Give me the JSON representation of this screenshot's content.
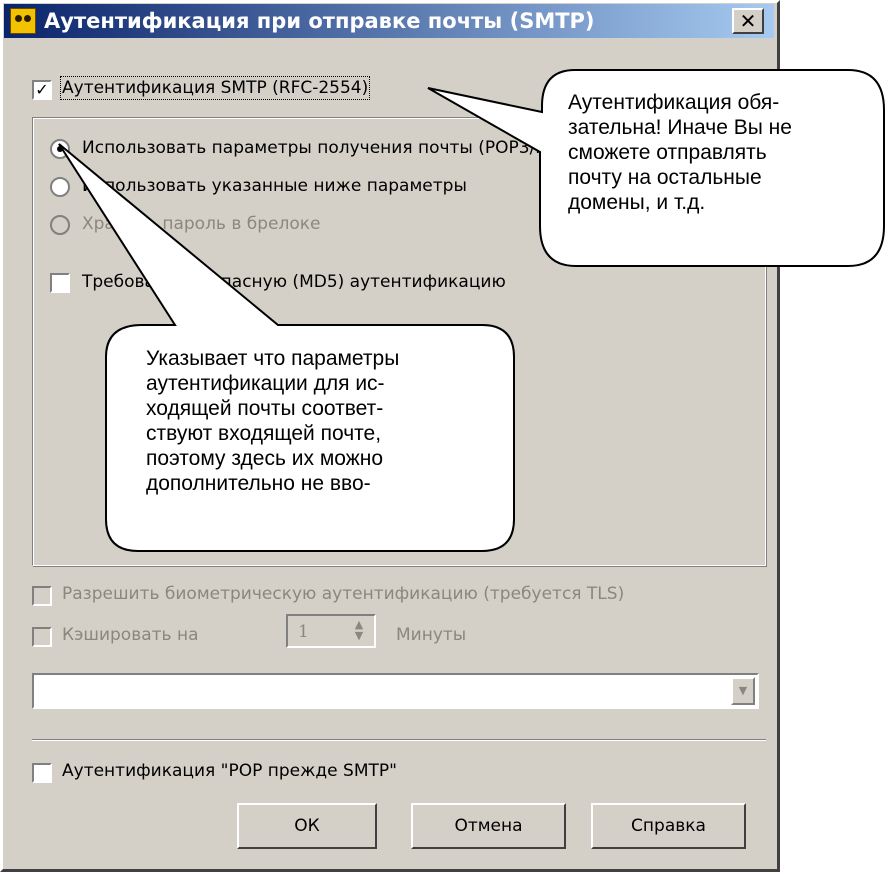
{
  "window": {
    "title": "Аутентификация при отправке почты (SMTP)",
    "close_glyph": "✕"
  },
  "smtp_auth": {
    "label": "Аутентификация SMTP (RFC-2554)",
    "checked": true
  },
  "auth_options": {
    "radio_use_incoming": "Использовать параметры получения почты (POP3/IMAP)",
    "radio_use_below": "Использовать указанные ниже параметры",
    "radio_keychain": "Хранить пароль в брелоке",
    "require_md5": "Требовать безопасную (MD5) аутентификацию"
  },
  "biometric": {
    "label": "Разрешить биометрическую аутентификацию (требуется TLS)"
  },
  "cache": {
    "label": "Кэшировать на",
    "value": "1",
    "unit": "Минуты"
  },
  "combo": {
    "value": ""
  },
  "pop_before_smtp": {
    "label": "Аутентификация \"POP прежде SMTP\""
  },
  "buttons": {
    "ok": "ОК",
    "cancel": "Отмена",
    "help": "Справка"
  },
  "callouts": {
    "top_right": [
      "Аутентификация обя-",
      "зательна! Иначе Вы не",
      "сможете отправлять",
      "почту на остальные",
      "домены, и т.д."
    ],
    "middle": [
      "Указывает что параметры",
      "аутентификации для ис-",
      "ходящей почты соответ-",
      "ствуют входящей почте,",
      "поэтому здесь их можно",
      "дополнительно не вво-"
    ]
  },
  "colors": {
    "face": "#d4d0c8",
    "title_start": "#0a246a",
    "title_end": "#a6caf0",
    "disabled_text": "#8a877f"
  }
}
